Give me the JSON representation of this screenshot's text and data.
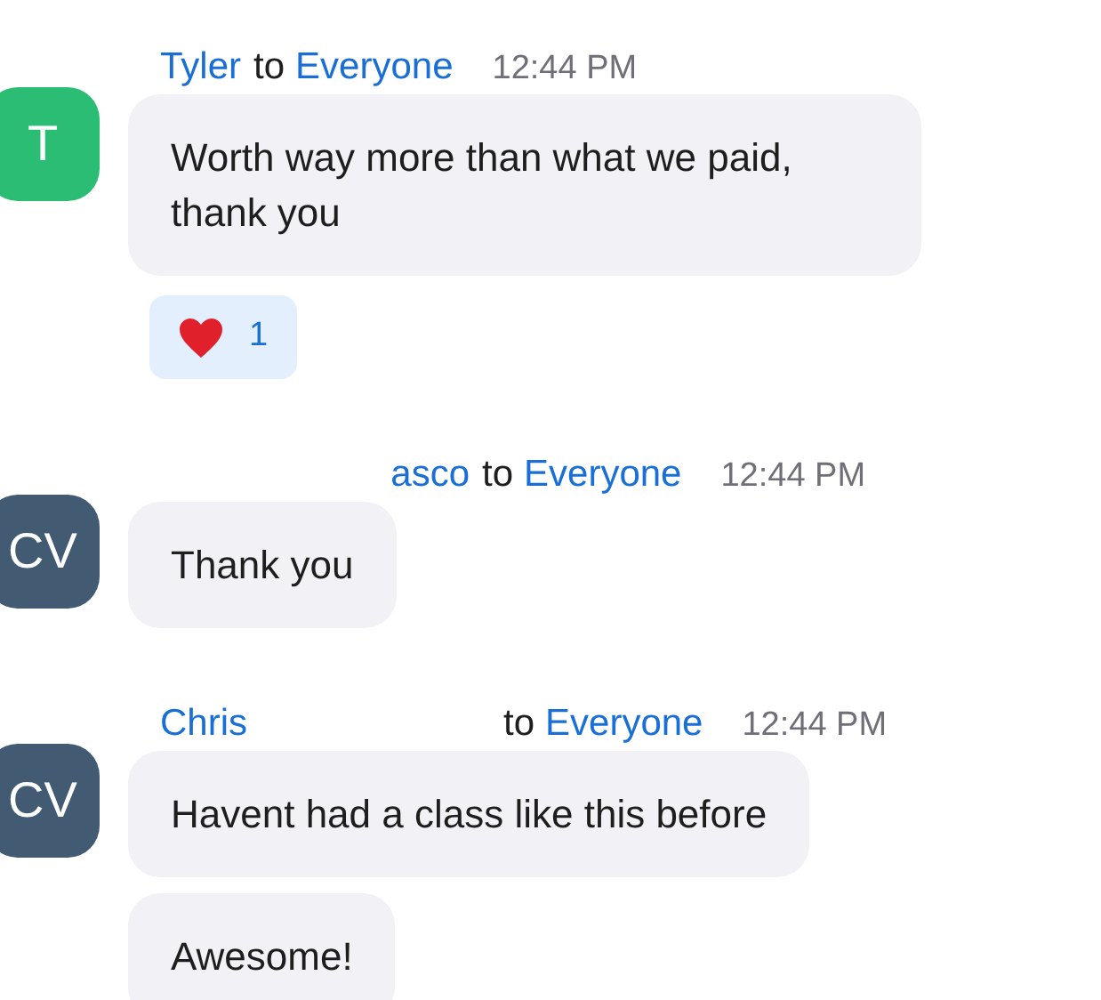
{
  "messages": [
    {
      "sender": "Tyler",
      "to": "to",
      "recipient": "Everyone",
      "time": "12:44 PM",
      "avatar": {
        "initials": "T",
        "color": "#2bbd74"
      },
      "hidden_before_name": false,
      "hidden_after_name": false,
      "bubbles": [
        "Worth way more than what we paid, thank you"
      ],
      "reactions": [
        {
          "count": "1"
        }
      ]
    },
    {
      "sender": "asco",
      "to": "to",
      "recipient": "Everyone",
      "time": "12:44 PM",
      "avatar": {
        "initials": "CV",
        "color": "#425a72"
      },
      "hidden_before_name": true,
      "hidden_after_name": false,
      "bubbles": [
        "Thank you"
      ]
    },
    {
      "sender": "Chris",
      "to": "to",
      "recipient": "Everyone",
      "time": "12:44 PM",
      "avatar": {
        "initials": "CV",
        "color": "#425a72"
      },
      "hidden_before_name": false,
      "hidden_after_name": true,
      "bubbles": [
        "Havent had a class like this before",
        "Awesome!"
      ]
    }
  ]
}
